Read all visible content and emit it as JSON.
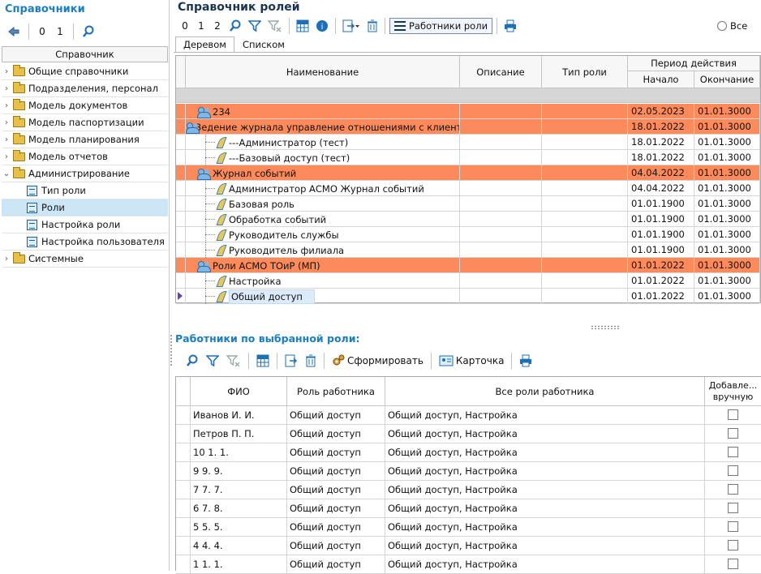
{
  "left": {
    "title": "Справочники",
    "tb_zero": "0",
    "tb_one": "1",
    "column_header": "Справочник",
    "tree": [
      {
        "label": "Общие справочники",
        "type": "folder",
        "expanded": false
      },
      {
        "label": "Подразделения, персонал",
        "type": "folder",
        "expanded": false
      },
      {
        "label": "Модель документов",
        "type": "folder",
        "expanded": false
      },
      {
        "label": "Модель паспортизации",
        "type": "folder",
        "expanded": false
      },
      {
        "label": "Модель планирования",
        "type": "folder",
        "expanded": false
      },
      {
        "label": "Модель отчетов",
        "type": "folder",
        "expanded": false
      },
      {
        "label": "Администрирование",
        "type": "folder",
        "expanded": true
      },
      {
        "label": "Тип роли",
        "type": "doc"
      },
      {
        "label": "Роли",
        "type": "doc",
        "selected": true
      },
      {
        "label": "Настройка роли",
        "type": "doc"
      },
      {
        "label": "Настройка пользователя",
        "type": "doc"
      },
      {
        "label": "Системные",
        "type": "folder",
        "expanded": false
      }
    ]
  },
  "main": {
    "title": "Справочник ролей",
    "tb_zero": "0",
    "tb_one": "1",
    "tb_two": "2",
    "workers_button": "Работники роли",
    "radio_all": "Все",
    "tabs": [
      "Деревом",
      "Списком"
    ],
    "active_tab": 0,
    "columns": {
      "name": "Наименование",
      "description": "Описание",
      "role_type": "Тип роли",
      "period": "Период действия",
      "start": "Начало",
      "end": "Окончание"
    },
    "rows": [
      {
        "name": "234",
        "level": 0,
        "group": true,
        "start": "02.05.2023",
        "end": "01.01.3000"
      },
      {
        "name": "--Ведение журнала управление отношениями с клиентами",
        "level": 0,
        "group": true,
        "start": "18.01.2022",
        "end": "01.01.3000"
      },
      {
        "name": "---Администратор (тест)",
        "level": 1,
        "group": false,
        "start": "18.01.2022",
        "end": "01.01.3000"
      },
      {
        "name": "---Базовый доступ (тест)",
        "level": 1,
        "group": false,
        "start": "18.01.2022",
        "end": "01.01.3000"
      },
      {
        "name": "Журнал событий",
        "level": 0,
        "group": true,
        "start": "04.04.2022",
        "end": "01.01.3000"
      },
      {
        "name": "Администратор АСМО Журнал событий",
        "level": 1,
        "group": false,
        "start": "04.04.2022",
        "end": "01.01.3000"
      },
      {
        "name": "Базовая роль",
        "level": 1,
        "group": false,
        "start": "01.01.1900",
        "end": "01.01.3000"
      },
      {
        "name": "Обработка событий",
        "level": 1,
        "group": false,
        "start": "01.01.1900",
        "end": "01.01.3000"
      },
      {
        "name": "Руководитель службы",
        "level": 1,
        "group": false,
        "start": "01.01.1900",
        "end": "01.01.3000"
      },
      {
        "name": "Руководитель филиала",
        "level": 1,
        "group": false,
        "start": "01.01.1900",
        "end": "01.01.3000"
      },
      {
        "name": "Роли АСМО ТОиР (МП)",
        "level": 0,
        "group": true,
        "start": "01.01.2022",
        "end": "01.01.3000"
      },
      {
        "name": "Настройка",
        "level": 1,
        "group": false,
        "start": "01.01.2022",
        "end": "01.01.3000"
      },
      {
        "name": "Общий доступ",
        "level": 1,
        "group": false,
        "start": "01.01.2022",
        "end": "01.01.3000",
        "current": true
      }
    ],
    "colors": {
      "group_row": "#fd8a5a",
      "accent": "#1a7fc0"
    }
  },
  "workers": {
    "title": "Работники по выбранной роли:",
    "form_button": "Сформировать",
    "card_button": "Карточка",
    "columns": {
      "fio": "ФИО",
      "role": "Роль работника",
      "all_roles": "Все роли работника",
      "manual": "Добавле... вручную"
    },
    "rows": [
      {
        "fio": "Иванов И. И.",
        "role": "Общий доступ",
        "all_roles": "Общий доступ, Настройка",
        "manual": false
      },
      {
        "fio": "Петров П. П.",
        "role": "Общий доступ",
        "all_roles": "Общий доступ, Настройка",
        "manual": false
      },
      {
        "fio": "10 1. 1.",
        "role": "Общий доступ",
        "all_roles": "Общий доступ, Настройка",
        "manual": false
      },
      {
        "fio": "9 9. 9.",
        "role": "Общий доступ",
        "all_roles": "Общий доступ, Настройка",
        "manual": false
      },
      {
        "fio": "7 7. 7.",
        "role": "Общий доступ",
        "all_roles": "Общий доступ, Настройка",
        "manual": false
      },
      {
        "fio": "6 7. 8.",
        "role": "Общий доступ",
        "all_roles": "Общий доступ, Настройка",
        "manual": false
      },
      {
        "fio": "5 5. 5.",
        "role": "Общий доступ",
        "all_roles": "Общий доступ, Настройка",
        "manual": false
      },
      {
        "fio": "4 4. 4.",
        "role": "Общий доступ",
        "all_roles": "Общий доступ, Настройка",
        "manual": false
      },
      {
        "fio": "1 1. 1.",
        "role": "Общий доступ",
        "all_roles": "Общий доступ, Настройка",
        "manual": false
      }
    ]
  }
}
